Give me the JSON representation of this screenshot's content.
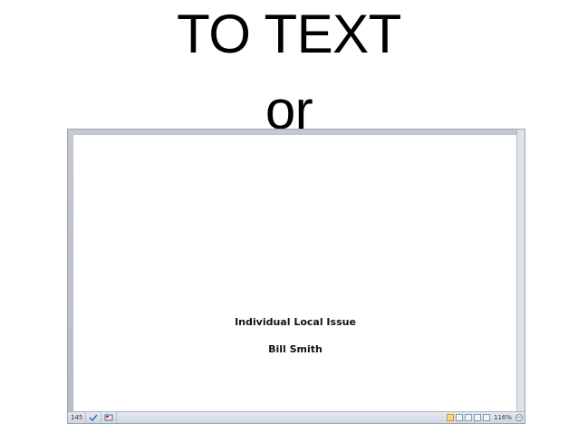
{
  "slide": {
    "heading_line_1": "TO TEXT",
    "heading_line_2": "or"
  },
  "document": {
    "lines": [
      "Individual Local Issue",
      "Bill Smith"
    ]
  },
  "status_bar": {
    "word_count": "145",
    "zoom_level": "116%",
    "zoom_out_glyph": "−",
    "proofing_icon": "spelling-check-icon",
    "macro_icon": "macro-record-icon"
  },
  "colors": {
    "window_frame": "#a7adb6",
    "page": "#ffffff",
    "active_view": "#f7d68a"
  }
}
